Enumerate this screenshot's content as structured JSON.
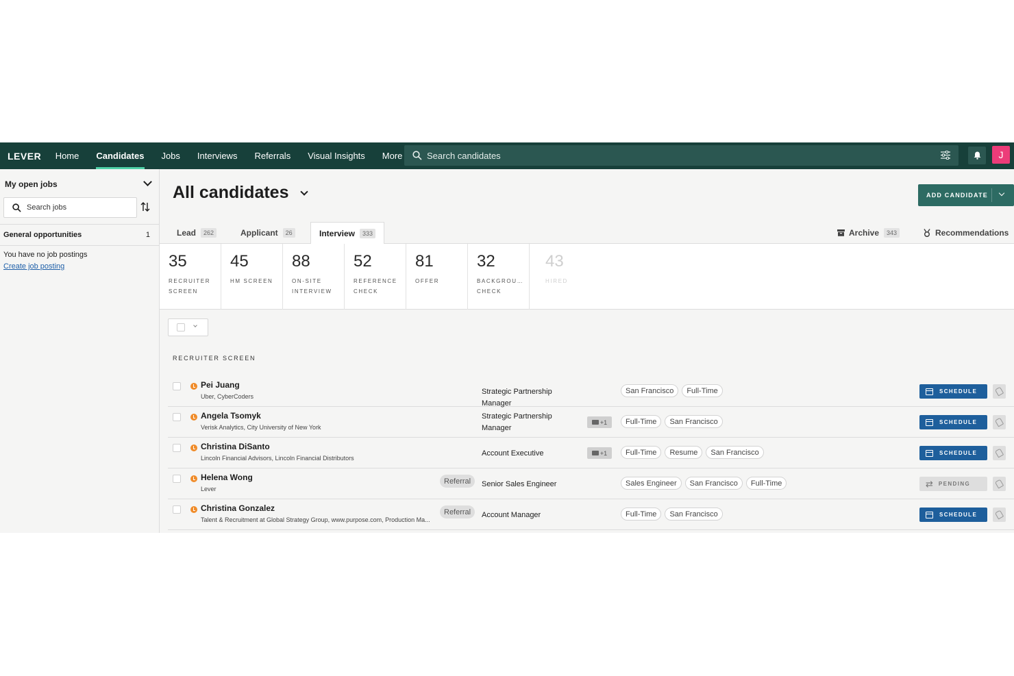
{
  "nav": {
    "logo": "LEVER",
    "items": [
      "Home",
      "Candidates",
      "Jobs",
      "Interviews",
      "Referrals",
      "Visual Insights",
      "More"
    ],
    "search_placeholder": "Search candidates",
    "avatar_initial": "J"
  },
  "sidebar": {
    "title": "My open jobs",
    "search_placeholder": "Search jobs",
    "general_label": "General opportunities",
    "general_count": "1",
    "empty_text": "You have no job postings",
    "create_link": "Create job posting"
  },
  "main": {
    "title": "All candidates",
    "add_button": "ADD CANDIDATE",
    "tabs": [
      {
        "label": "Lead",
        "count": "262"
      },
      {
        "label": "Applicant",
        "count": "26"
      },
      {
        "label": "Interview",
        "count": "333"
      }
    ],
    "archive": {
      "label": "Archive",
      "count": "343"
    },
    "recommendations": "Recommendations",
    "stages": [
      {
        "count": "35",
        "label": "RECRUITER SCREEN"
      },
      {
        "count": "45",
        "label": "HM SCREEN"
      },
      {
        "count": "88",
        "label": "ON-SITE INTERVIEW"
      },
      {
        "count": "52",
        "label": "REFERENCE CHECK"
      },
      {
        "count": "81",
        "label": "OFFER"
      },
      {
        "count": "32",
        "label": "BACKGROU… CHECK"
      },
      {
        "count": "43",
        "label": "HIRED"
      }
    ],
    "section_label": "RECRUITER SCREEN",
    "candidates": [
      {
        "name": "Pei Juang",
        "sub": "Uber, CyberCoders",
        "referral": "",
        "position": "Strategic Partnership Manager",
        "multi": "",
        "tags": [
          "San Francisco",
          "Full-Time"
        ],
        "action": "SCHEDULE"
      },
      {
        "name": "Angela Tsomyk",
        "sub": "Verisk Analytics, City University of New York",
        "referral": "",
        "position": "Strategic Partnership Manager",
        "multi": "+1",
        "tags": [
          "Full-Time",
          "San Francisco"
        ],
        "action": "SCHEDULE"
      },
      {
        "name": "Christina DiSanto",
        "sub": "Lincoln Financial Advisors, Lincoln Financial Distributors",
        "referral": "",
        "position": "Account Executive",
        "multi": "+1",
        "tags": [
          "Full-Time",
          "Resume",
          "San Francisco"
        ],
        "action": "SCHEDULE"
      },
      {
        "name": "Helena Wong",
        "sub": "Lever",
        "referral": "Referral",
        "position": "Senior Sales Engineer",
        "multi": "",
        "tags": [
          "Sales Engineer",
          "San Francisco",
          "Full-Time"
        ],
        "action": "PENDING"
      },
      {
        "name": "Christina Gonzalez",
        "sub": "Talent & Recruitment at Global Strategy Group, www.purpose.com, Production Ma...",
        "referral": "Referral",
        "position": "Account Manager",
        "multi": "",
        "tags": [
          "Full-Time",
          "San Francisco"
        ],
        "action": "SCHEDULE"
      }
    ]
  }
}
